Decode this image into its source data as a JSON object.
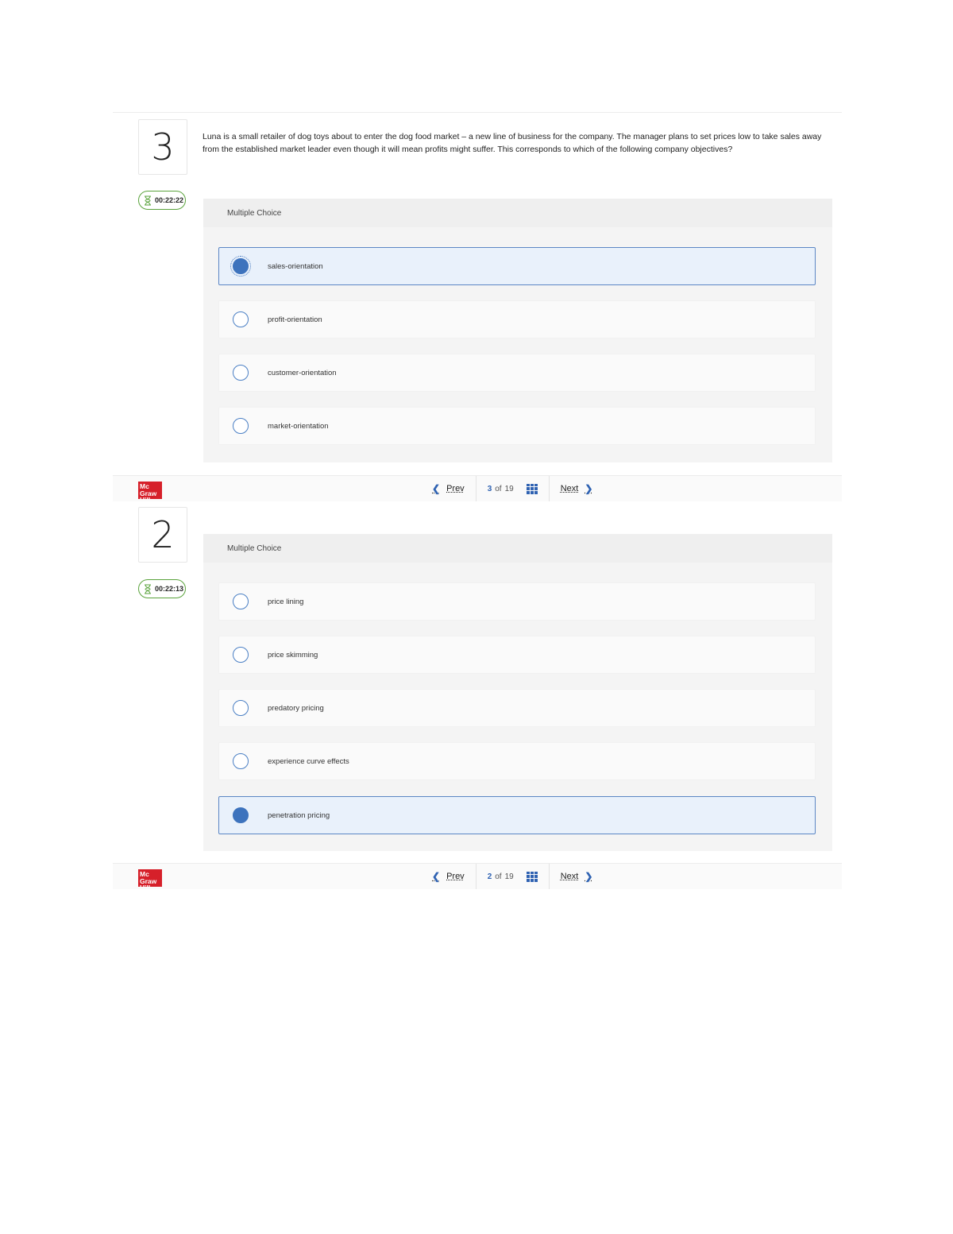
{
  "question1": {
    "number": "3",
    "timer": "00:22:22",
    "text": "Luna is a small retailer of dog toys about to enter the dog food market – a new line of business for the company. The manager plans to set prices low to take sales away from the established market leader even though it will mean profits might suffer. This corresponds to which of the following company objectives?",
    "type_label": "Multiple Choice",
    "options": [
      {
        "label": "sales-orientation",
        "selected": true
      },
      {
        "label": "profit-orientation",
        "selected": false
      },
      {
        "label": "customer-orientation",
        "selected": false
      },
      {
        "label": "market-orientation",
        "selected": false
      }
    ],
    "nav": {
      "prev": "Prev",
      "current": "3",
      "of": "of",
      "total": "19",
      "next": "Next"
    }
  },
  "question2": {
    "number": "2",
    "timer": "00:22:13",
    "type_label": "Multiple Choice",
    "options": [
      {
        "label": "price lining",
        "selected": false
      },
      {
        "label": "price skimming",
        "selected": false
      },
      {
        "label": "predatory pricing",
        "selected": false
      },
      {
        "label": "experience curve effects",
        "selected": false
      },
      {
        "label": "penetration pricing",
        "selected": true
      }
    ],
    "nav": {
      "prev": "Prev",
      "current": "2",
      "of": "of",
      "total": "19",
      "next": "Next"
    }
  },
  "brand": {
    "logo_text": "Mc Graw Hill",
    "color": "#d6202a"
  },
  "colors": {
    "accent": "#3d73bd",
    "timer_border": "#5aa33c"
  }
}
